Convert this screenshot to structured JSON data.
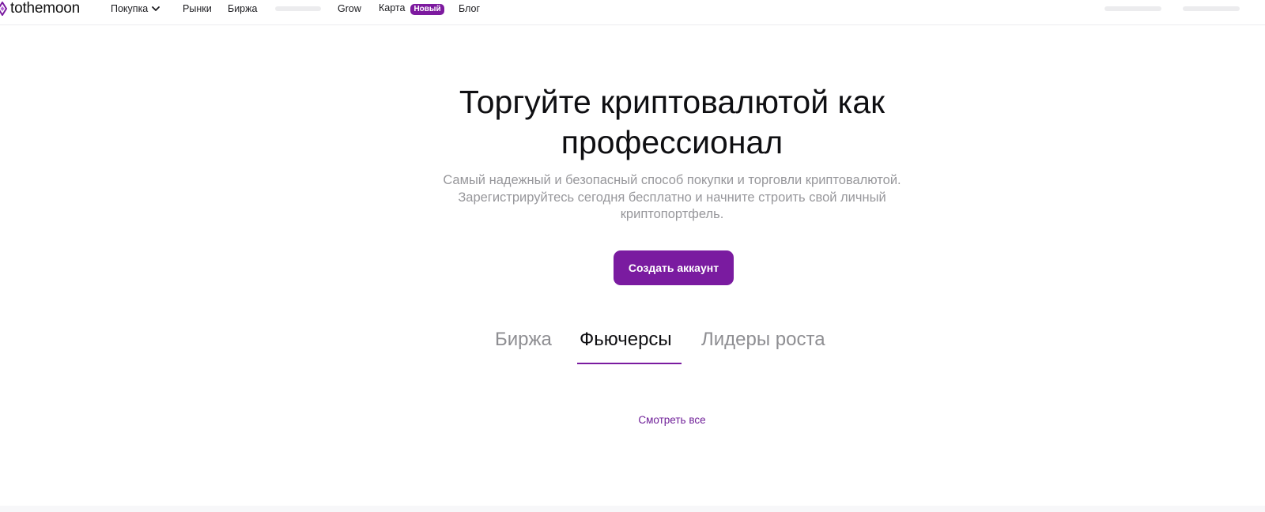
{
  "brand": {
    "name": "tothemoon",
    "accent": "#7a1ba0"
  },
  "nav": {
    "items": [
      {
        "label": "Покупка",
        "has_dropdown": true
      },
      {
        "label": "Рынки"
      },
      {
        "label": "Биржа"
      },
      {
        "label": "Grow"
      },
      {
        "label": "Карта",
        "badge": "Новый"
      },
      {
        "label": "Блог"
      }
    ]
  },
  "hero": {
    "title_line1": "Торгуйте криптовалютой как",
    "title_line2": "профессионал",
    "subtitle_line1": "Самый надежный и безопасный способ покупки и торговли криптовалютой.",
    "subtitle_line2": "Зарегистрируйтесь сегодня бесплатно и начните строить свой личный",
    "subtitle_line3": "криптопортфель.",
    "cta_label": "Создать аккаунт"
  },
  "tabs": {
    "items": [
      {
        "label": "Биржа",
        "active": false
      },
      {
        "label": "Фьючерсы",
        "active": true
      },
      {
        "label": "Лидеры роста",
        "active": false
      }
    ]
  },
  "see_all_label": "Смотреть все"
}
